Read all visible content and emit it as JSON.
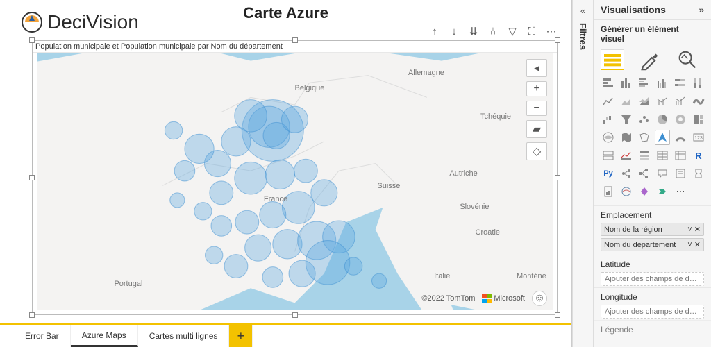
{
  "logo_text": "DeciVision",
  "page_title": "Carte Azure",
  "visual_title": "Population municipale et Population municipale par Nom du département",
  "attribution": "©2022 TomTom",
  "ms_label": "Microsoft",
  "tabs": {
    "error": "Error Bar",
    "azure": "Azure Maps",
    "multi": "Cartes multi lignes"
  },
  "filters_label": "Filtres",
  "viz_pane": {
    "header": "Visualisations",
    "sub": "Générer un élément visuel",
    "sections": {
      "emplacement": "Emplacement",
      "latitude": "Latitude",
      "longitude": "Longitude",
      "legende": "Légende"
    },
    "pills": {
      "region": "Nom de la région",
      "dept": "Nom du département"
    },
    "drop_placeholder": "Ajouter des champs de don..."
  },
  "countries": {
    "france": "France",
    "belgique": "Belgique",
    "allemagne": "Allemagne",
    "tchequie": "Tchéquie",
    "autriche": "Autriche",
    "suisse": "Suisse",
    "slovenie": "Slovénie",
    "croatie": "Croatie",
    "italie": "Italie",
    "montene": "Monténé",
    "portugal": "Portugal"
  }
}
